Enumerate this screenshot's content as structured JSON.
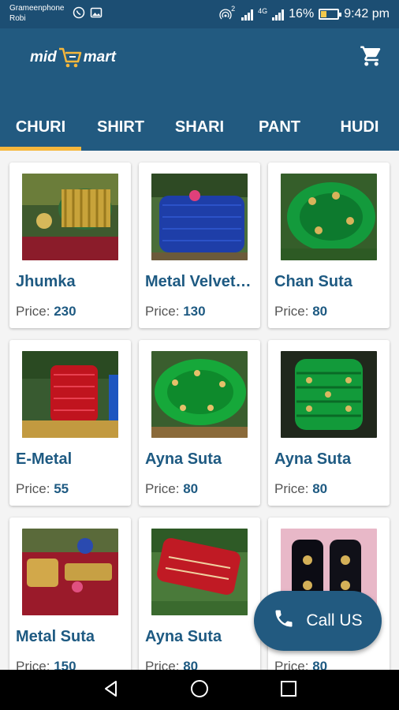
{
  "status_bar": {
    "carrier_line1": "Grameenphone",
    "carrier_line2": "Robi",
    "hotspot_badge": "2",
    "net_type": "4G",
    "battery": "16%",
    "time": "9:42 pm"
  },
  "app_bar": {
    "logo_left": "mid",
    "logo_right": "mart",
    "tabs": [
      {
        "label": "CHURI",
        "active": true
      },
      {
        "label": "SHIRT",
        "active": false
      },
      {
        "label": "SHARI",
        "active": false
      },
      {
        "label": "PANT",
        "active": false
      },
      {
        "label": "HUDI",
        "active": false
      }
    ]
  },
  "products": [
    {
      "name": "Jhumka",
      "price_label": "Price:",
      "price": "230"
    },
    {
      "name": "Metal Velvet…",
      "price_label": "Price:",
      "price": "130"
    },
    {
      "name": "Chan Suta",
      "price_label": "Price:",
      "price": "80"
    },
    {
      "name": "E-Metal",
      "price_label": "Price:",
      "price": "55"
    },
    {
      "name": "Ayna Suta",
      "price_label": "Price:",
      "price": "80"
    },
    {
      "name": "Ayna Suta",
      "price_label": "Price:",
      "price": "80"
    },
    {
      "name": "Metal Suta",
      "price_label": "Price:",
      "price": "150"
    },
    {
      "name": "Ayna Suta",
      "price_label": "Price:",
      "price": "80"
    },
    {
      "name": "",
      "price_label": "Price:",
      "price": "80"
    }
  ],
  "call_button": {
    "label": "Call US"
  },
  "colors": {
    "primary": "#225a80",
    "status_bar": "#1c4e73",
    "accent": "#f6b73c",
    "product_text": "#1e5a82"
  },
  "icons": [
    "whatsapp-icon",
    "gallery-icon",
    "hotspot-icon",
    "signal-icon",
    "battery-icon",
    "cart-icon",
    "phone-icon",
    "back-icon",
    "home-icon",
    "recents-icon"
  ]
}
